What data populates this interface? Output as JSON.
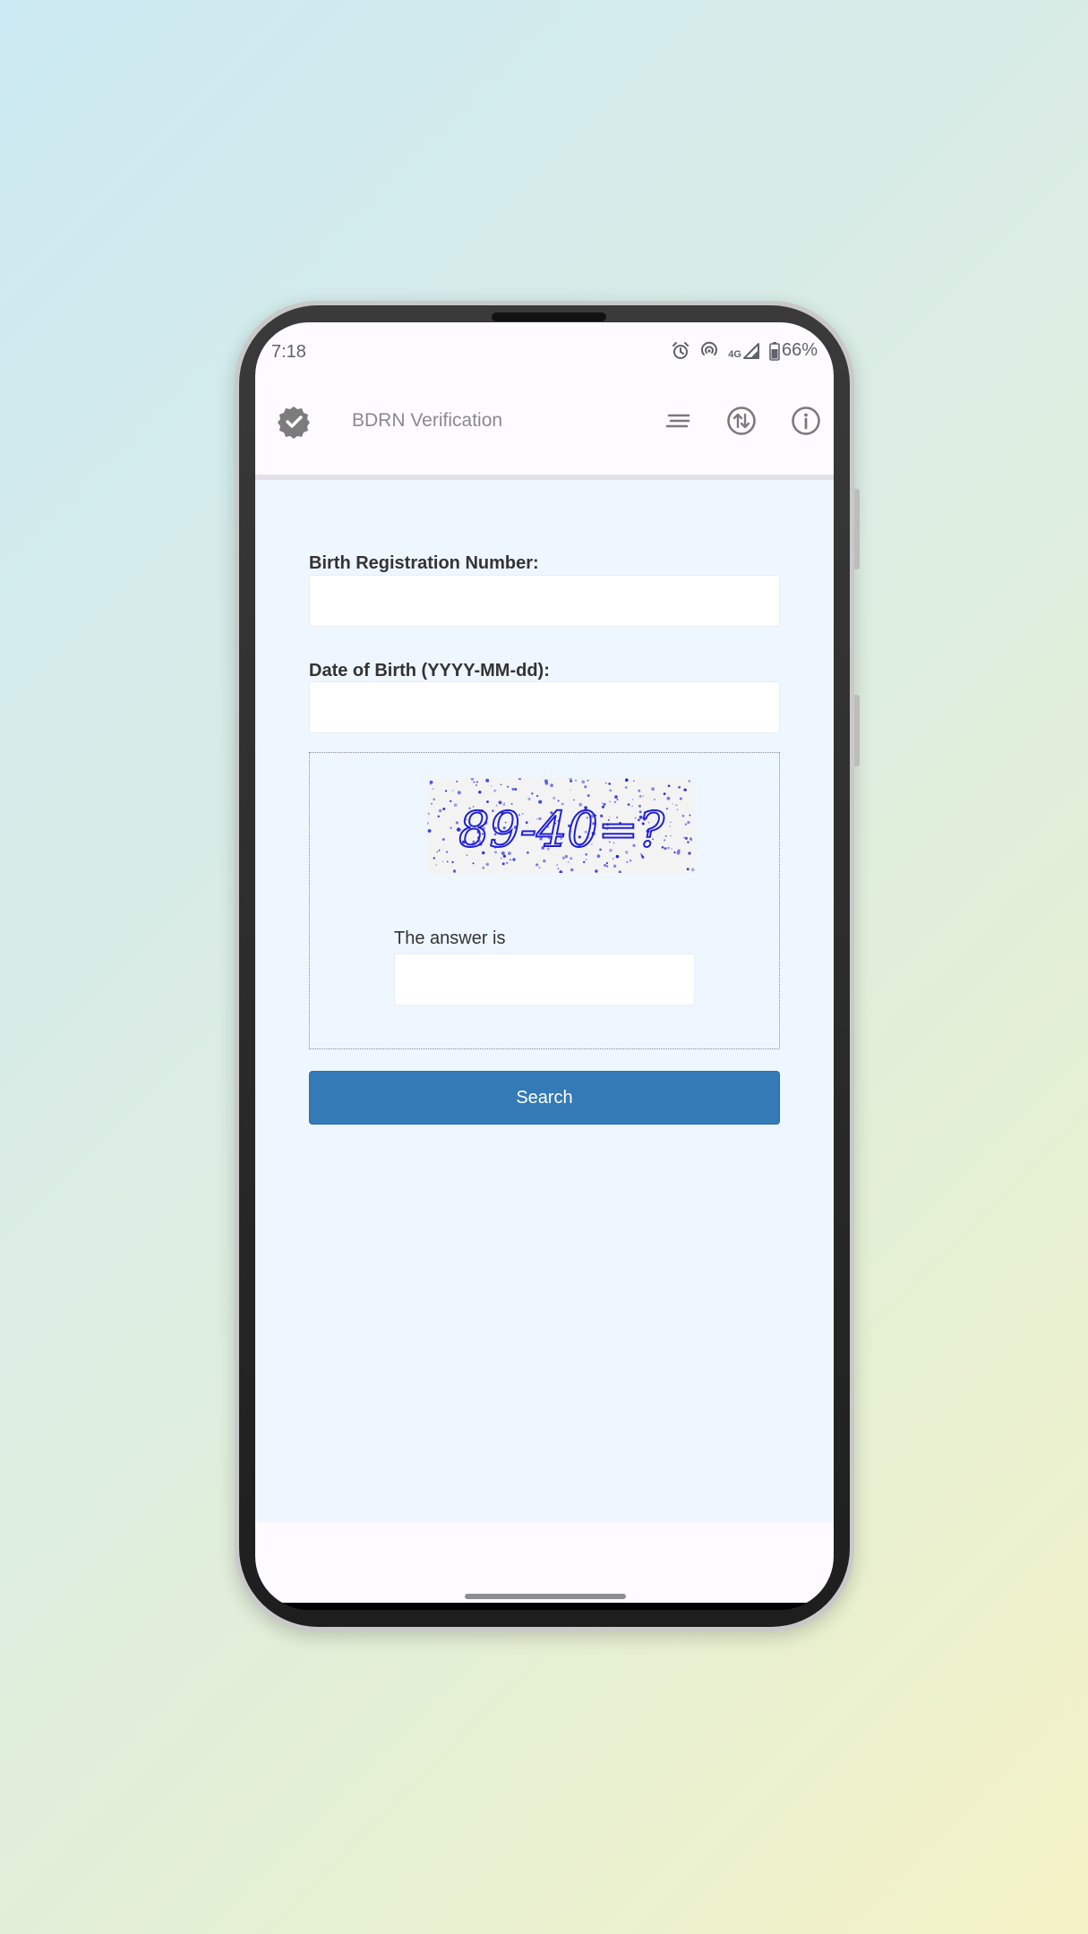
{
  "status_bar": {
    "time": "7:18",
    "network": "4G",
    "battery": "66%",
    "icons": [
      "alarm-icon",
      "hotspot-icon",
      "signal-icon",
      "battery-icon"
    ]
  },
  "app_bar": {
    "title": "BDRN Verification",
    "logo_icon": "verified-badge-icon",
    "actions": [
      "menu-lines-icon",
      "swap-icon",
      "info-icon"
    ]
  },
  "form": {
    "brn_label": "Birth Registration Number:",
    "brn_value": "",
    "dob_label": "Date of Birth (YYYY-MM-dd):",
    "dob_value": "",
    "captcha": {
      "image_text": "89-40=?",
      "answer_label": "The answer is",
      "answer_value": ""
    },
    "search_label": "Search"
  },
  "colors": {
    "content_bg": "#eef6ff",
    "button_primary": "#337ab7",
    "captcha_ink": "#1f1fd6"
  }
}
